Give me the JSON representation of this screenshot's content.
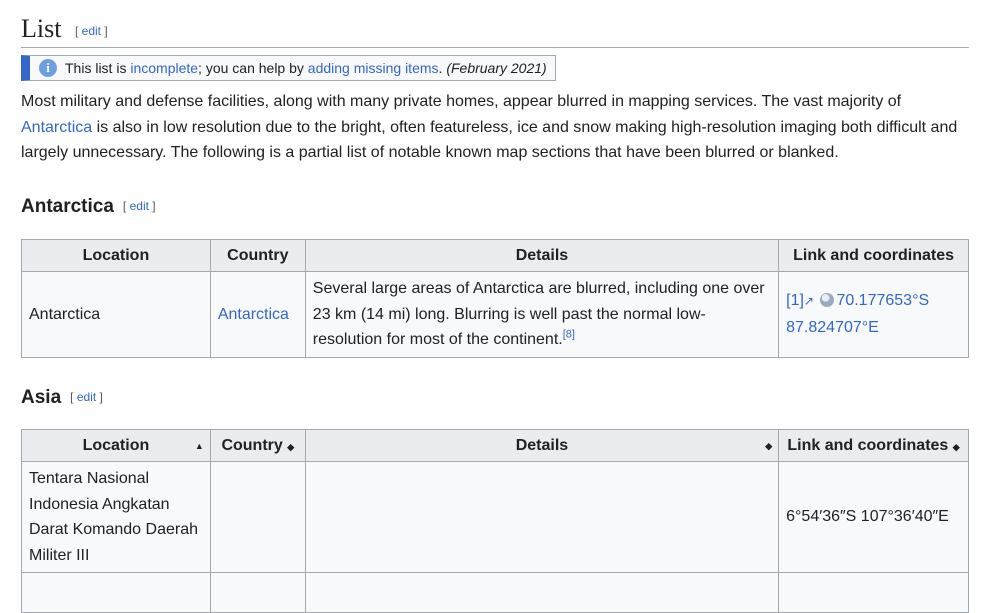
{
  "section": {
    "title": "List",
    "edit_open": "[",
    "edit_label": "edit",
    "edit_close": "]"
  },
  "ambox": {
    "text1": "This list is ",
    "link1": "incomplete",
    "text2": "; you can help by ",
    "link2": "adding missing items",
    "text3": ". ",
    "date": "(February 2021)"
  },
  "intro": {
    "text1": "Most military and defense facilities, along with many private homes, appear blurred in mapping services. The vast majority of ",
    "link": "Antarctica",
    "text2": " is also in low resolution due to the bright, often featureless, ice and snow making high-resolution imaging both difficult and largely unnecessary. The following is a partial list of notable known map sections that have been blurred or blanked."
  },
  "antarctica": {
    "heading": "Antarctica",
    "edit_label": "edit",
    "headers": [
      "Location",
      "Country",
      "Details",
      "Link and coordinates"
    ],
    "row": {
      "location": "Antarctica",
      "country": "Antarctica",
      "details": "Several large areas of Antarctica are blurred, including one over 23 km (14 mi) long. Blurring is well past the normal low-resolution for most of the continent.",
      "ref": "[8]",
      "link": "[1]",
      "coords": "70.177653°S 87.824707°E"
    }
  },
  "asia": {
    "heading": "Asia",
    "edit_label": "edit",
    "headers": [
      "Location",
      "Country",
      "Details",
      "Link and coordinates"
    ],
    "row": {
      "location": "Tentara Nasional Indonesia Angkatan Darat Komando Daerah Militer III",
      "country": "",
      "details": "",
      "coords": "6°54′36″S 107°36′40″E"
    }
  },
  "icons": {
    "info": "info-icon",
    "external": "external-link-icon",
    "globe": "globe-icon",
    "sort": "sort-icon"
  }
}
